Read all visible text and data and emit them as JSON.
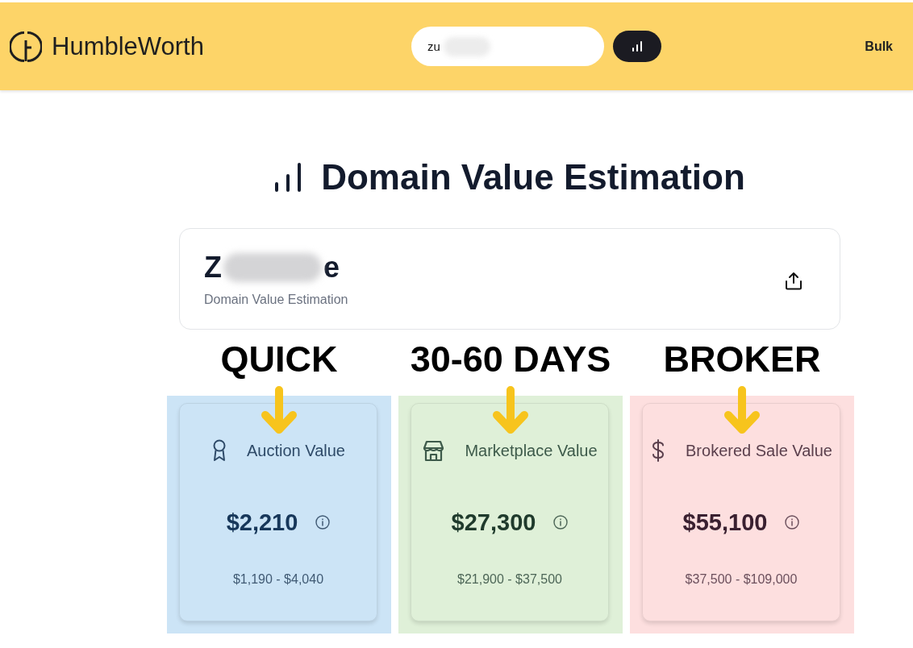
{
  "header": {
    "logo_text": "HumbleWorth",
    "search": {
      "value": "zu",
      "redacted": true
    },
    "nav_link": "Bulk"
  },
  "title": "Domain Value Estimation",
  "domain_card": {
    "name_start": "Z",
    "name_end": "e",
    "redacted": true,
    "subtitle": "Domain Value Estimation"
  },
  "estimates": [
    {
      "tag": "QUICK",
      "color": "#cce4f6",
      "kind": "auction",
      "label": "Auction Value",
      "value": "$2,210",
      "range": "$1,190 - $4,040"
    },
    {
      "tag": "30-60 DAYS",
      "color": "#dff0d8",
      "kind": "marketplace",
      "label": "Marketplace Value",
      "value": "$27,300",
      "range": "$21,900 - $37,500"
    },
    {
      "tag": "BROKER",
      "color": "#fddfdf",
      "kind": "broker",
      "label": "Brokered Sale Value",
      "value": "$55,100",
      "range": "$37,500 - $109,000"
    }
  ]
}
